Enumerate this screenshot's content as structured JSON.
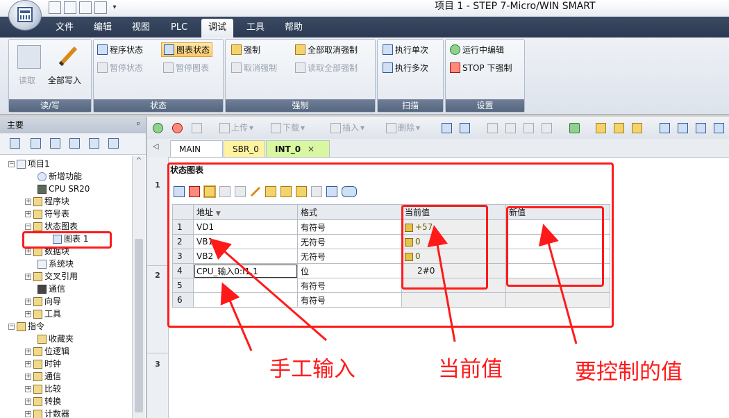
{
  "window": {
    "title": "项目 1 - STEP 7-Micro/WIN SMART"
  },
  "ribbon_tabs": [
    "文件",
    "编辑",
    "视图",
    "PLC",
    "调试",
    "工具",
    "帮助"
  ],
  "ribbon": {
    "groups": {
      "readwrite": {
        "label": "读/写",
        "read": "读取",
        "write_all": "全部写入"
      },
      "status": {
        "label": "状态",
        "program_status": "程序状态",
        "chart_status": "图表状态",
        "pause_status": "暂停状态",
        "pause_chart": "暂停图表"
      },
      "force": {
        "label": "强制",
        "force": "强制",
        "unforce_all": "全部取消强制",
        "unforce": "取消强制",
        "read_all_forced": "读取全部强制"
      },
      "scan": {
        "label": "扫描",
        "single": "执行单次",
        "multiple": "执行多次"
      },
      "settings": {
        "label": "设置",
        "run_edit": "运行中编辑",
        "stop_force": "STOP 下强制"
      }
    }
  },
  "left_pane": {
    "title": "主要",
    "pin": "ᵖ",
    "tree": [
      {
        "label": "项目1"
      },
      {
        "label": "新增功能"
      },
      {
        "label": "CPU SR20"
      },
      {
        "label": "程序块"
      },
      {
        "label": "符号表"
      },
      {
        "label": "状态图表"
      },
      {
        "label": "图表 1"
      },
      {
        "label": "数据块"
      },
      {
        "label": "系统块"
      },
      {
        "label": "交叉引用"
      },
      {
        "label": "通信"
      },
      {
        "label": "向导"
      },
      {
        "label": "工具"
      },
      {
        "label": "指令"
      },
      {
        "label": "收藏夹"
      },
      {
        "label": "位逻辑"
      },
      {
        "label": "时钟"
      },
      {
        "label": "通信"
      },
      {
        "label": "比较"
      },
      {
        "label": "转换"
      },
      {
        "label": "计数器"
      }
    ]
  },
  "main_toolbar": {
    "upload": "上传",
    "download": "下载",
    "insert": "插入",
    "delete": "删除"
  },
  "editor_tabs": [
    {
      "label": "MAIN"
    },
    {
      "label": "SBR_0"
    },
    {
      "label": "INT_0",
      "close": "✕"
    }
  ],
  "gutter": [
    "1",
    "2",
    "3"
  ],
  "status_chart": {
    "title": "状态图表",
    "columns": [
      "地址",
      "格式",
      "当前值",
      "新值"
    ],
    "sort_glyph": "▼",
    "rows": [
      {
        "n": "1",
        "address": "VD1",
        "format": "有符号",
        "current": "+57",
        "new": ""
      },
      {
        "n": "2",
        "address": "VB1",
        "format": "无符号",
        "current": "0",
        "new": ""
      },
      {
        "n": "3",
        "address": "VB2",
        "format": "无符号",
        "current": "0",
        "new": ""
      },
      {
        "n": "4",
        "address": "CPU_输入0:I1.1",
        "format": "位",
        "current": "2#0",
        "new": ""
      },
      {
        "n": "5",
        "address": "",
        "format": "有符号",
        "current": "",
        "new": ""
      },
      {
        "n": "6",
        "address": "",
        "format": "有符号",
        "current": "",
        "new": ""
      }
    ]
  },
  "annotations": {
    "manual_input": "手工输入",
    "current_value": "当前值",
    "value_to_control": "要控制的值"
  },
  "colors": {
    "annotation_red": "#ff1a1a",
    "ribbon_dark": "#2b3a52",
    "pressed": "#ffc86a"
  }
}
